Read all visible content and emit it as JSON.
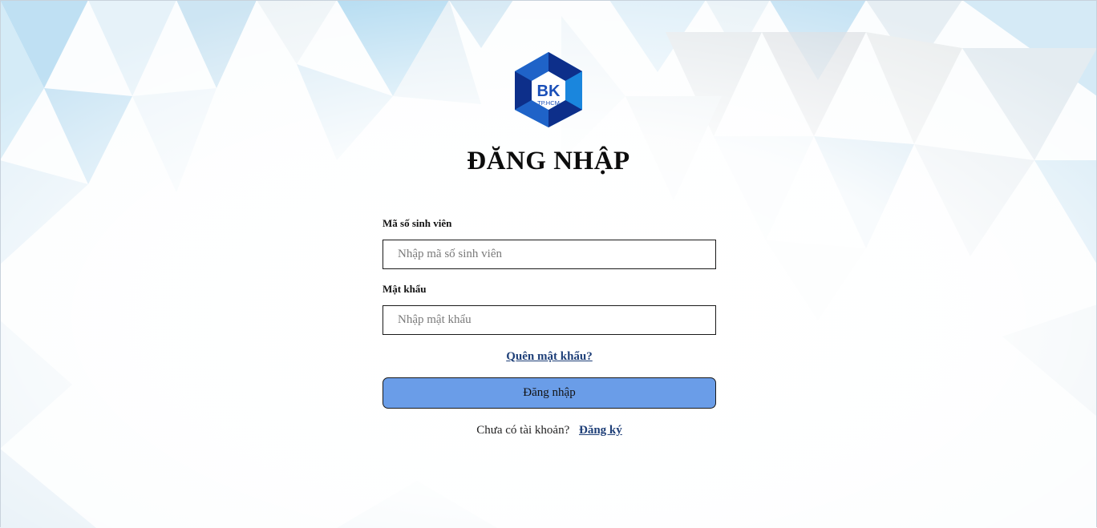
{
  "page": {
    "title": "ĐĂNG NHẬP",
    "logo": {
      "initials": "BK",
      "subtitle": "TP.HCM"
    }
  },
  "form": {
    "student_id_label": "Mã số sinh viên",
    "student_id_placeholder": "Nhập mã số sinh viên",
    "student_id_value": "",
    "password_label": "Mật khẩu",
    "password_placeholder": "Nhập mật khẩu",
    "password_value": "",
    "forgot_link": "Quên mật khẩu?",
    "submit_label": "Đăng nhập",
    "no_account_prompt": "Chưa có tài khoản?",
    "register_link": "Đăng ký"
  },
  "colors": {
    "button_bg": "#6a9de8",
    "link": "#1e3f78",
    "logo_dark": "#0d2f8a",
    "logo_light": "#1a86dd",
    "background_tint": "#cfe6f4"
  },
  "icons": {
    "logo": "bk-university-logo"
  }
}
